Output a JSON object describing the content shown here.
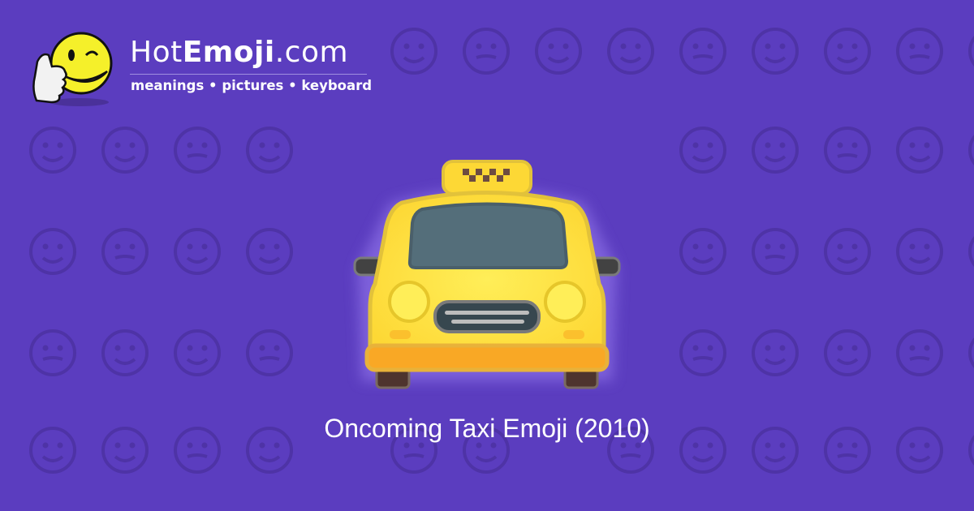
{
  "brand": {
    "name_prefix": "Hot",
    "name_bold": "Emoji",
    "name_suffix": ".com",
    "tagline": "meanings • pictures • keyboard"
  },
  "caption": "Oncoming Taxi Emoji (2010)",
  "colors": {
    "background": "#5b3dbf",
    "pattern": "#4e33a6",
    "taxi_body": "#fdd835",
    "windshield": "#546e7a",
    "bumper": "#f9a825"
  },
  "icons": {
    "logo": "winking-thumbs-up-smiley",
    "main": "oncoming-taxi",
    "pattern": "faded-emoji-faces"
  }
}
